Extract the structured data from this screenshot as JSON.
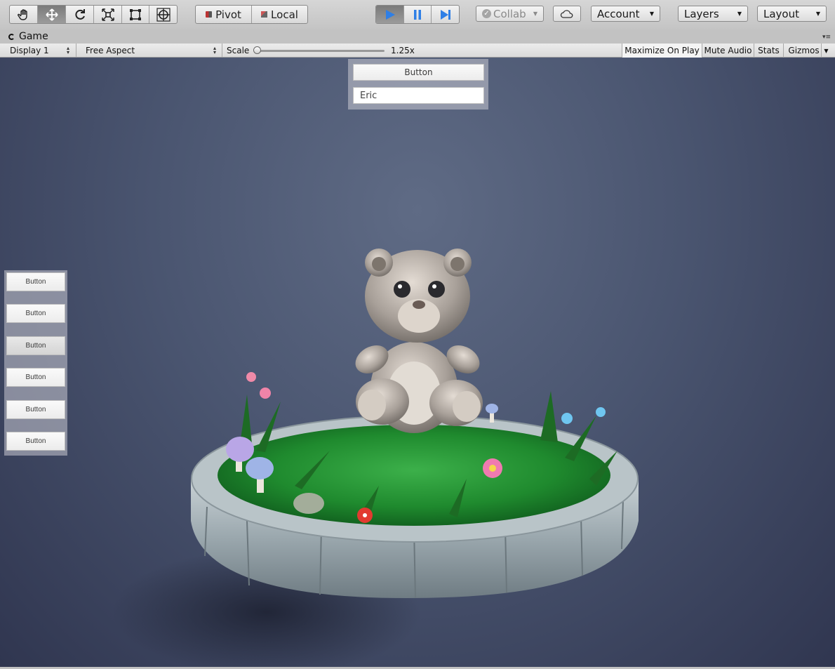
{
  "toolbar": {
    "tools": [
      {
        "name": "hand-tool-icon",
        "active": false
      },
      {
        "name": "move-tool-icon",
        "active": true
      },
      {
        "name": "rotate-tool-icon",
        "active": false
      },
      {
        "name": "scale-tool-icon",
        "active": false
      },
      {
        "name": "rect-tool-icon",
        "active": false
      },
      {
        "name": "transform-tool-icon",
        "active": false
      }
    ],
    "pivot_label": "Pivot",
    "local_label": "Local",
    "collab_label": "Collab",
    "account_label": "Account",
    "layers_label": "Layers",
    "layout_label": "Layout",
    "play_active": true,
    "accent_color": "#3a7be0"
  },
  "tab": {
    "title": "Game"
  },
  "game_toolbar": {
    "display": "Display 1",
    "aspect": "Free Aspect",
    "scale_label": "Scale",
    "scale_value": "1.25x",
    "maximize_on_play": "Maximize On Play",
    "mute_audio": "Mute Audio",
    "stats": "Stats",
    "gizmos": "Gizmos"
  },
  "game_ui": {
    "top_button": "Button",
    "name_input": "Eric",
    "side_buttons": [
      "Button",
      "Button",
      "Button",
      "Button",
      "Button",
      "Button"
    ]
  }
}
